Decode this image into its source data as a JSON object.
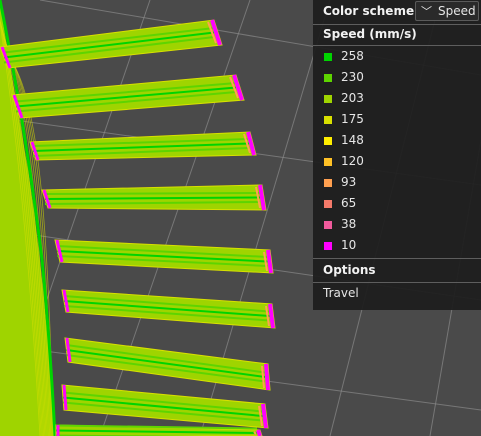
{
  "panel": {
    "header": "Color scheme",
    "scheme_value": "Speed",
    "speed_title": "Speed (mm/s)",
    "options_title": "Options",
    "option_items": [
      {
        "label": "Travel"
      }
    ]
  },
  "legend": [
    {
      "value": "258",
      "color": "#00d400"
    },
    {
      "value": "230",
      "color": "#5ed400"
    },
    {
      "value": "203",
      "color": "#9fd400"
    },
    {
      "value": "175",
      "color": "#d9e000"
    },
    {
      "value": "148",
      "color": "#ffee00"
    },
    {
      "value": "120",
      "color": "#ffc126"
    },
    {
      "value": "93",
      "color": "#ffa050"
    },
    {
      "value": "65",
      "color": "#f47a6a"
    },
    {
      "value": "38",
      "color": "#f05a9c"
    },
    {
      "value": "10",
      "color": "#ff00ff"
    }
  ],
  "colors": {
    "background": "#4a4a4a",
    "grid": "#8a8a8a",
    "bulk_fill": "#9fd400",
    "fast_line": "#00d400",
    "medium_line": "#5ed400",
    "outline": "#d9e000",
    "end_cap": "#ff00ff",
    "end_cap_mid": "#ffa050"
  }
}
